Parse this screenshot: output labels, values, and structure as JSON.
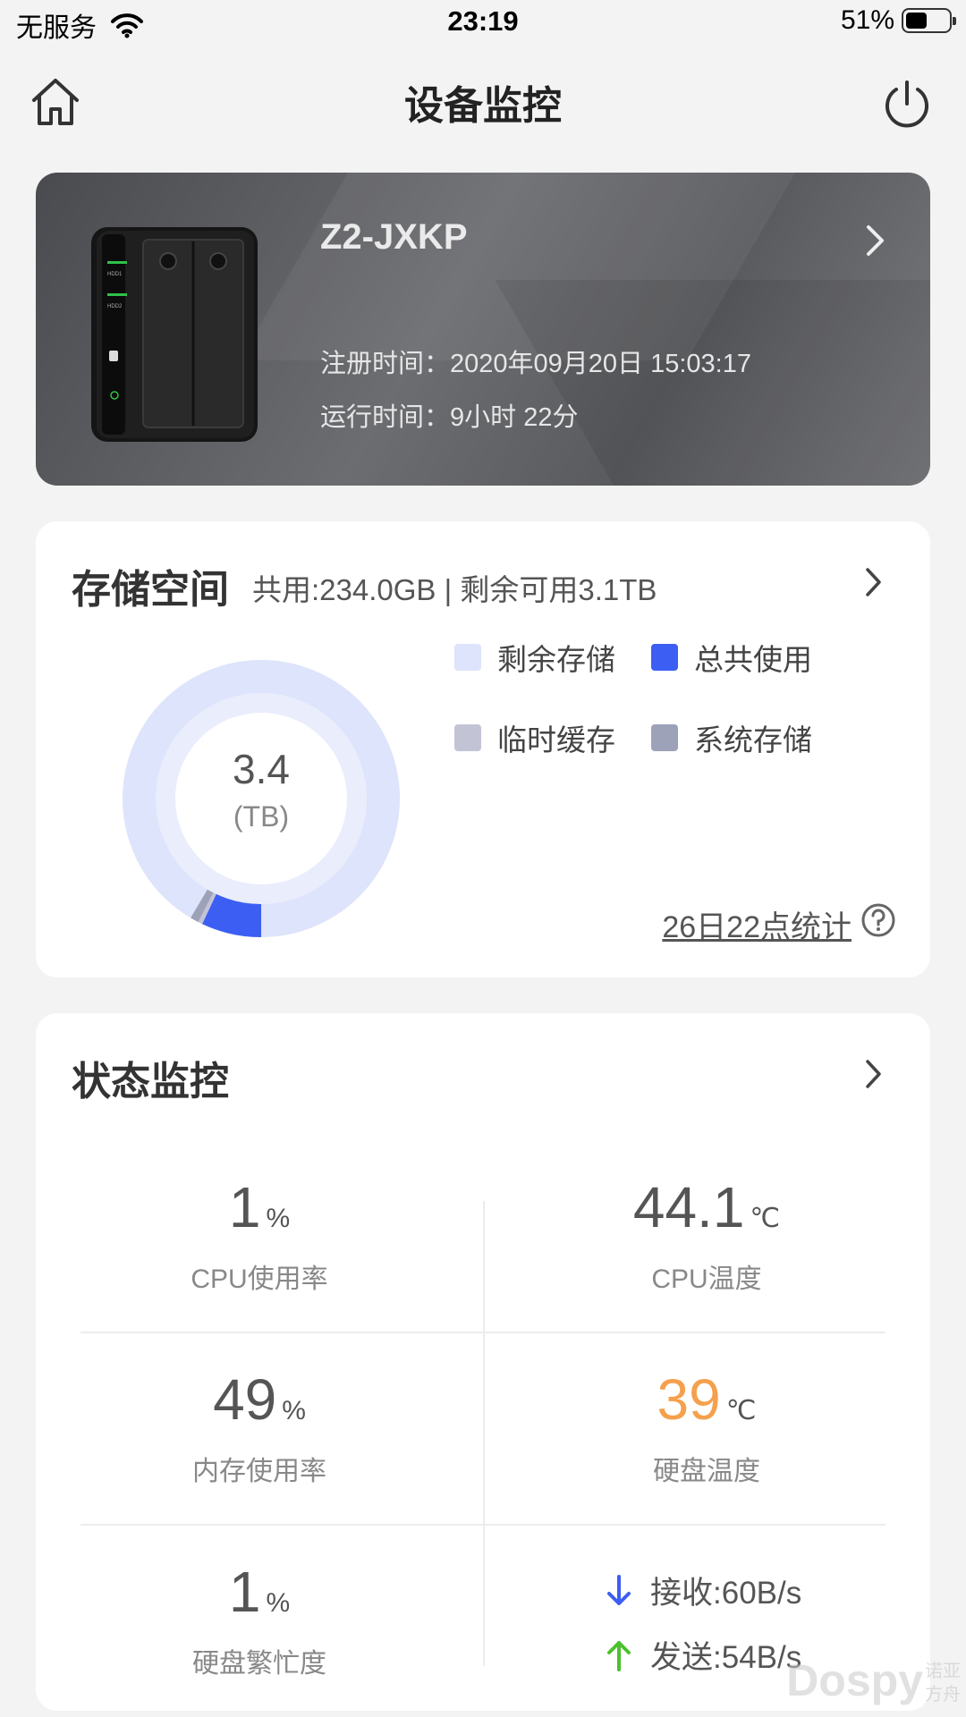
{
  "status_bar": {
    "carrier": "无服务",
    "time": "23:19",
    "battery": "51%",
    "battery_level": 0.51
  },
  "nav": {
    "title": "设备监控",
    "home_icon": "home-icon",
    "power_icon": "power-icon"
  },
  "device": {
    "name": "Z2-JXKP",
    "register_label": "注册时间：",
    "register_time": "2020年09月20日 15:03:17",
    "uptime_label": "运行时间：",
    "uptime": "9小时 22分"
  },
  "storage": {
    "title": "存储空间",
    "summary": "共用:234.0GB | 剩余可用3.1TB",
    "total_value": "3.4",
    "total_unit": "(TB)",
    "legend": [
      {
        "label": "剩余存储",
        "color": "#dde4fb"
      },
      {
        "label": "总共使用",
        "color": "#3d5ef2"
      },
      {
        "label": "临时缓存",
        "color": "#c2c4d6"
      },
      {
        "label": "系统存储",
        "color": "#9ea2b8"
      }
    ],
    "stat_date": "26日22点统计"
  },
  "chart_data": {
    "type": "pie",
    "total": "3.4",
    "unit": "(TB)",
    "categories": [
      "剩余存储",
      "总共使用",
      "临时缓存",
      "系统存储"
    ],
    "values": [
      0.915,
      0.07,
      0.005,
      0.01
    ]
  },
  "status": {
    "title": "状态监控",
    "metrics": [
      {
        "value": "1",
        "unit": "%",
        "label": "CPU使用率"
      },
      {
        "value": "44.1",
        "unit": "℃",
        "label": "CPU温度"
      },
      {
        "value": "49",
        "unit": "%",
        "label": "内存使用率"
      },
      {
        "value": "39",
        "unit": "℃",
        "label": "硬盘温度"
      },
      {
        "value": "1",
        "unit": "%",
        "label": "硬盘繁忙度"
      }
    ],
    "receive": "接收:60B/s",
    "send": "发送:54B/s"
  },
  "watermark": {
    "text": "Dospy",
    "cn": "诺亚方舟"
  }
}
